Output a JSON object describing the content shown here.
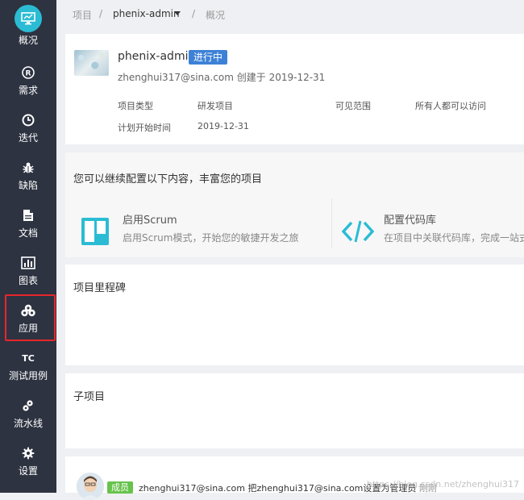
{
  "sidebar": {
    "items": [
      {
        "label": "概况",
        "icon": "monitor-icon"
      },
      {
        "label": "需求",
        "icon": "registered-icon"
      },
      {
        "label": "迭代",
        "icon": "clock-icon"
      },
      {
        "label": "缺陷",
        "icon": "bug-icon"
      },
      {
        "label": "文档",
        "icon": "document-icon"
      },
      {
        "label": "图表",
        "icon": "bar-chart-icon"
      },
      {
        "label": "应用",
        "icon": "apps-icon"
      },
      {
        "label": "测试用例",
        "icon": "tc-icon",
        "icon_text": "TC"
      },
      {
        "label": "流水线",
        "icon": "pipeline-icon"
      },
      {
        "label": "设置",
        "icon": "gear-icon"
      }
    ],
    "highlight_color": "#e8262b"
  },
  "breadcrumb": {
    "root": "项目",
    "sep": "/",
    "project": "phenix-admin",
    "current": "概况"
  },
  "project": {
    "name": "phenix-admin",
    "status": "进行中",
    "meta": "zhenghui317@sina.com 创建于 2019-12-31",
    "fields": [
      {
        "label": "项目类型",
        "value": "研发项目"
      },
      {
        "label": "可见范围",
        "value": "所有人都可以访问"
      },
      {
        "label": "计划开始时间",
        "value": "2019-12-31"
      }
    ]
  },
  "config": {
    "title": "您可以继续配置以下内容，丰富您的项目",
    "options": [
      {
        "title": "启用Scrum",
        "desc": "启用Scrum模式，开始您的敏捷开发之旅",
        "icon": "scrum-board-icon"
      },
      {
        "title": "配置代码库",
        "desc": "在项目中关联代码库，完成一站式",
        "icon": "code-icon"
      }
    ]
  },
  "milestones": {
    "title": "项目里程碑"
  },
  "subprojects": {
    "title": "子项目"
  },
  "activity": {
    "badge": "成员",
    "text": "zhenghui317@sina.com 把zhenghui317@sina.com设置为管理员",
    "time": "刚刚"
  },
  "watermark": "https://blog.csdn.net/zhenghui317",
  "colors": {
    "accent": "#2bbcd4",
    "status": "#3d81d6",
    "member": "#66c34b",
    "sidebar": "#2d3341"
  }
}
